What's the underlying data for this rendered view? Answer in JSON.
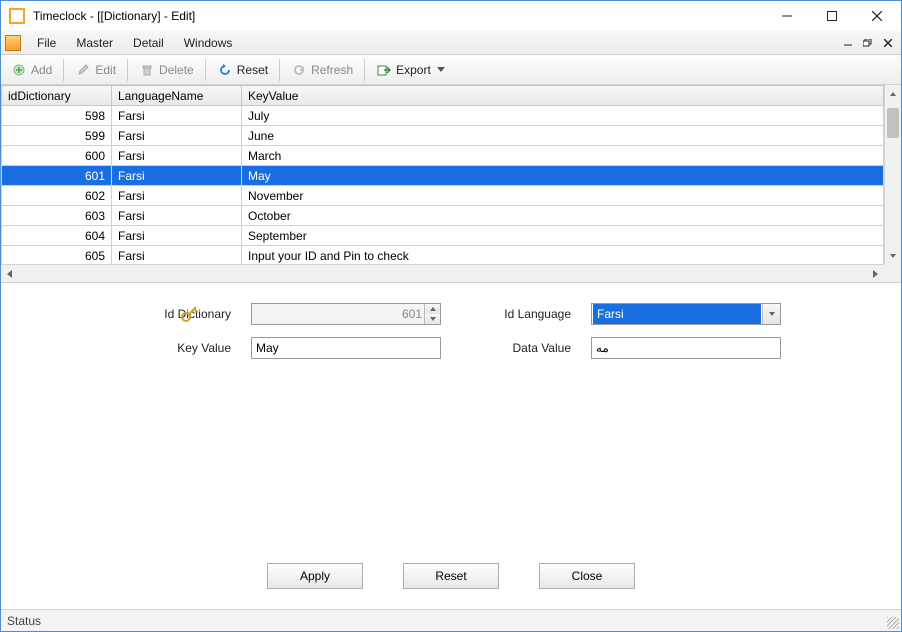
{
  "window": {
    "title": "Timeclock - [[Dictionary] - Edit]"
  },
  "menu": {
    "file": "File",
    "master": "Master",
    "detail": "Detail",
    "windows": "Windows"
  },
  "toolbar": {
    "add": "Add",
    "edit": "Edit",
    "delete": "Delete",
    "reset": "Reset",
    "refresh": "Refresh",
    "export": "Export"
  },
  "grid": {
    "headers": {
      "id": "idDictionary",
      "lang": "LanguageName",
      "key": "KeyValue"
    },
    "rows": [
      {
        "id": "598",
        "lang": "Farsi",
        "key": "July"
      },
      {
        "id": "599",
        "lang": "Farsi",
        "key": "June"
      },
      {
        "id": "600",
        "lang": "Farsi",
        "key": "March"
      },
      {
        "id": "601",
        "lang": "Farsi",
        "key": "May"
      },
      {
        "id": "602",
        "lang": "Farsi",
        "key": "November"
      },
      {
        "id": "603",
        "lang": "Farsi",
        "key": "October"
      },
      {
        "id": "604",
        "lang": "Farsi",
        "key": "September"
      },
      {
        "id": "605",
        "lang": "Farsi",
        "key": "Input your ID and Pin to check"
      }
    ],
    "selected_index": 3
  },
  "form": {
    "labels": {
      "id_dict": "Id Dictionary",
      "id_lang": "Id Language",
      "key_value": "Key Value",
      "data_value": "Data Value"
    },
    "id_dictionary": "601",
    "id_language": "Farsi",
    "key_value": "May",
    "data_value": "مه"
  },
  "buttons": {
    "apply": "Apply",
    "reset": "Reset",
    "close": "Close"
  },
  "status": {
    "text": "Status"
  }
}
